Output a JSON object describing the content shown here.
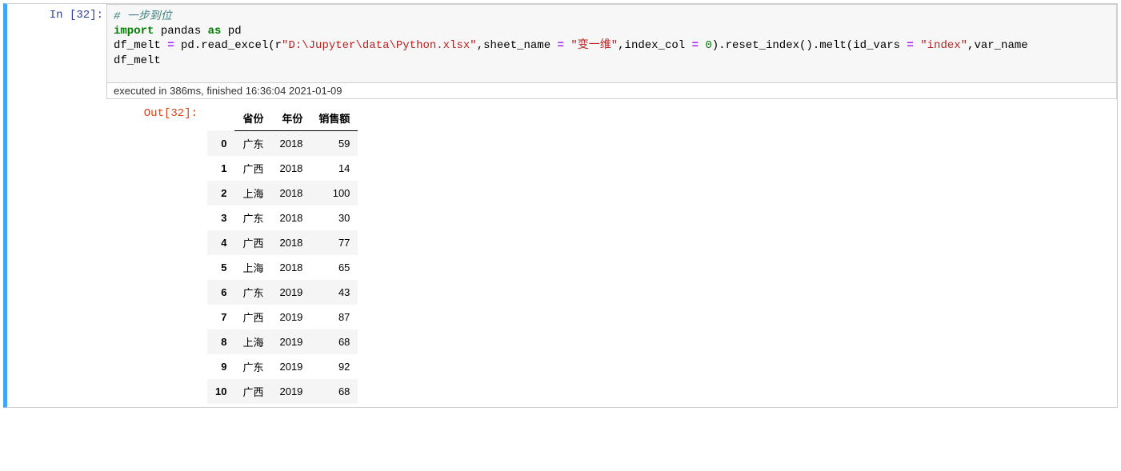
{
  "input_prompt": "In [32]:",
  "output_prompt": "Out[32]:",
  "exec_status": "executed in 386ms, finished 16:36:04 2021-01-09",
  "code": {
    "line1_comment": "# 一步到位",
    "line2_import": "import",
    "line2_pandas": " pandas ",
    "line2_as": "as",
    "line2_pd": " pd",
    "line3_a": "df_melt ",
    "line3_eq": "=",
    "line3_b": " pd.read_excel(r",
    "line3_str1": "\"D:\\Jupyter\\data\\Python.xlsx\"",
    "line3_c": ",sheet_name ",
    "line3_eq2": "=",
    "line3_sp1": " ",
    "line3_str2": "\"变一维\"",
    "line3_d": ",index_col ",
    "line3_eq3": "=",
    "line3_sp2": " ",
    "line3_num": "0",
    "line3_e": ").reset_index().melt(id_vars ",
    "line3_eq4": "=",
    "line3_sp3": " ",
    "line3_str3": "\"index\"",
    "line3_f": ",var_name",
    "line4": "df_melt"
  },
  "table": {
    "columns": [
      "省份",
      "年份",
      "销售额"
    ],
    "rows": [
      {
        "idx": "0",
        "c0": "广东",
        "c1": "2018",
        "c2": "59"
      },
      {
        "idx": "1",
        "c0": "广西",
        "c1": "2018",
        "c2": "14"
      },
      {
        "idx": "2",
        "c0": "上海",
        "c1": "2018",
        "c2": "100"
      },
      {
        "idx": "3",
        "c0": "广东",
        "c1": "2018",
        "c2": "30"
      },
      {
        "idx": "4",
        "c0": "广西",
        "c1": "2018",
        "c2": "77"
      },
      {
        "idx": "5",
        "c0": "上海",
        "c1": "2018",
        "c2": "65"
      },
      {
        "idx": "6",
        "c0": "广东",
        "c1": "2019",
        "c2": "43"
      },
      {
        "idx": "7",
        "c0": "广西",
        "c1": "2019",
        "c2": "87"
      },
      {
        "idx": "8",
        "c0": "上海",
        "c1": "2019",
        "c2": "68"
      },
      {
        "idx": "9",
        "c0": "广东",
        "c1": "2019",
        "c2": "92"
      },
      {
        "idx": "10",
        "c0": "广西",
        "c1": "2019",
        "c2": "68"
      }
    ]
  }
}
